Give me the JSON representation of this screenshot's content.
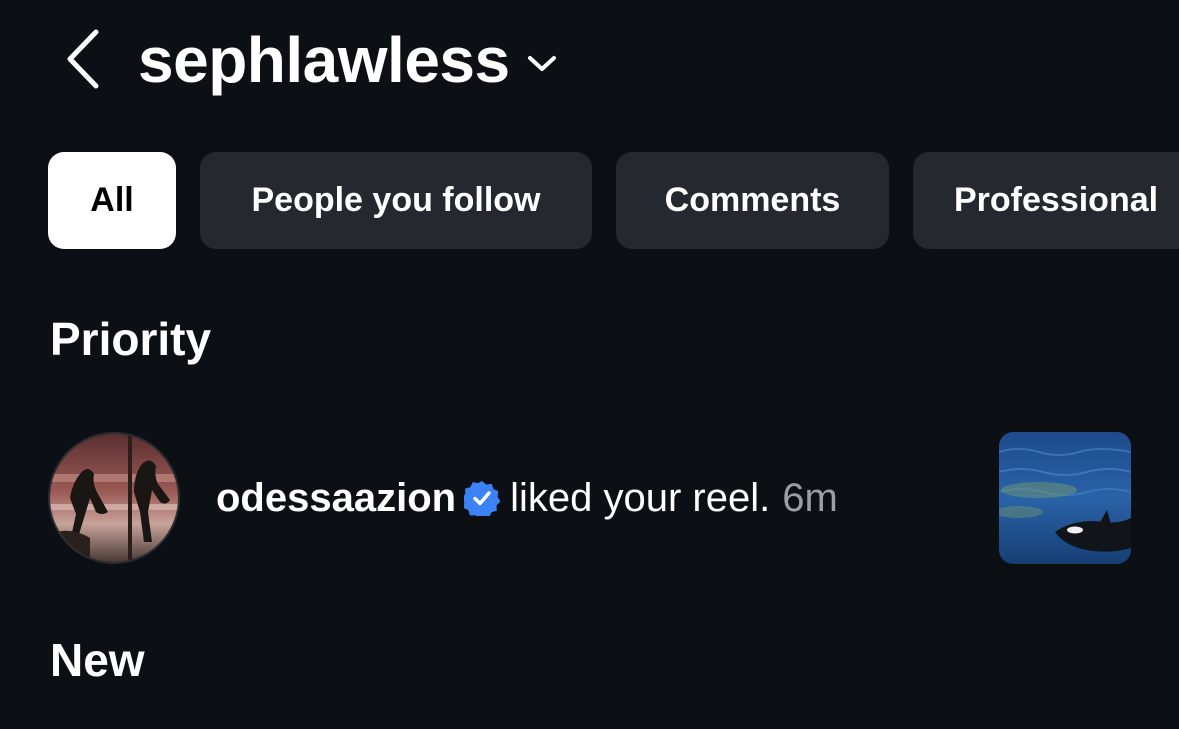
{
  "header": {
    "title": "sephlawless"
  },
  "tabs": [
    {
      "label": "All",
      "active": true
    },
    {
      "label": "People you follow",
      "active": false
    },
    {
      "label": "Comments",
      "active": false
    },
    {
      "label": "Professional",
      "active": false
    }
  ],
  "sections": {
    "priority": "Priority",
    "new": "New"
  },
  "notifications": [
    {
      "username": "odessaazion",
      "verified": true,
      "action": "liked your reel.",
      "time": "6m"
    }
  ],
  "colors": {
    "background": "#0c0f14",
    "tab_inactive": "#25282e",
    "tab_active": "#ffffff",
    "verified": "#3b82f6",
    "time_text": "#9a9ea6"
  },
  "icons": {
    "back": "back-chevron-icon",
    "dropdown": "chevron-down-icon",
    "verified": "verified-badge-icon"
  }
}
